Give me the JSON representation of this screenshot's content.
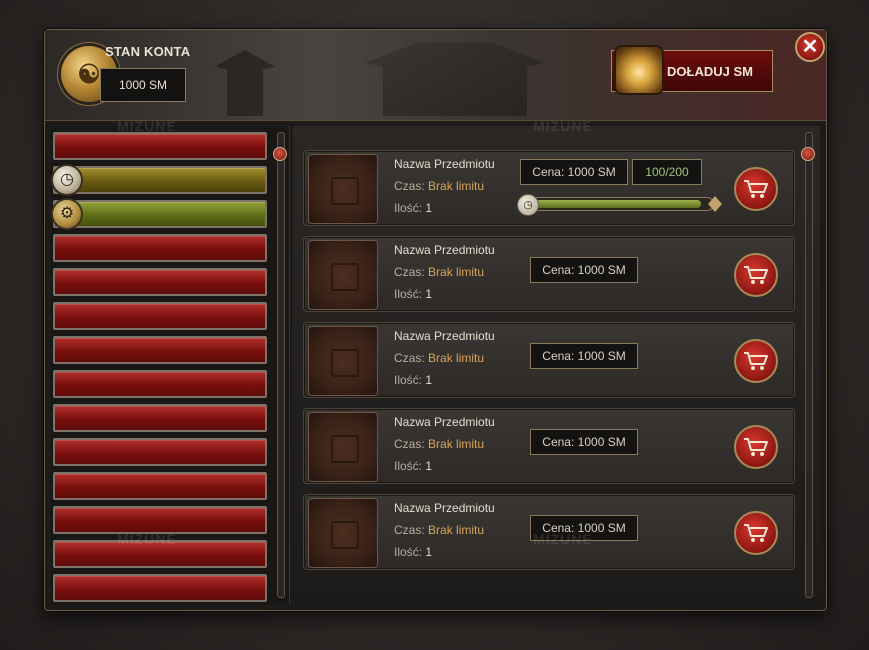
{
  "header": {
    "account_label": "STAN KONTA",
    "balance": "1000 SM",
    "topup_label": "DOŁADUJ SM",
    "close_symbol": "✕"
  },
  "watermark": "MIZUNE",
  "sidebar": {
    "items": [
      {
        "style": "red"
      },
      {
        "style": "gold",
        "icon": "clock-icon"
      },
      {
        "style": "green",
        "icon": "gear-icon"
      },
      {
        "style": "red"
      },
      {
        "style": "red"
      },
      {
        "style": "red"
      },
      {
        "style": "red"
      },
      {
        "style": "red"
      },
      {
        "style": "red"
      },
      {
        "style": "red"
      },
      {
        "style": "red"
      },
      {
        "style": "red"
      },
      {
        "style": "red"
      },
      {
        "style": "red"
      }
    ]
  },
  "items": [
    {
      "name": "Nazwa Przedmiotu",
      "time_label": "Czas:",
      "time_value": "Brak limitu",
      "qty_label": "Ilość:",
      "qty_value": "1",
      "price_label": "Cena:",
      "price_value": "1000 SM",
      "count": "100/200",
      "progress": 1.0
    },
    {
      "name": "Nazwa Przedmiotu",
      "time_label": "Czas:",
      "time_value": "Brak limitu",
      "qty_label": "Ilość:",
      "qty_value": "1",
      "price_label": "Cena:",
      "price_value": "1000 SM"
    },
    {
      "name": "Nazwa Przedmiotu",
      "time_label": "Czas:",
      "time_value": "Brak limitu",
      "qty_label": "Ilość:",
      "qty_value": "1",
      "price_label": "Cena:",
      "price_value": "1000 SM"
    },
    {
      "name": "Nazwa Przedmiotu",
      "time_label": "Czas:",
      "time_value": "Brak limitu",
      "qty_label": "Ilość:",
      "qty_value": "1",
      "price_label": "Cena:",
      "price_value": "1000 SM"
    },
    {
      "name": "Nazwa Przedmiotu",
      "time_label": "Czas:",
      "time_value": "Brak limitu",
      "qty_label": "Ilość:",
      "qty_value": "1",
      "price_label": "Cena:",
      "price_value": "1000 SM"
    }
  ],
  "colors": {
    "accent_red": "#8c1612",
    "gold_border": "#a88a57",
    "price_value": "#d8a45a",
    "count_green": "#9fc27a"
  }
}
